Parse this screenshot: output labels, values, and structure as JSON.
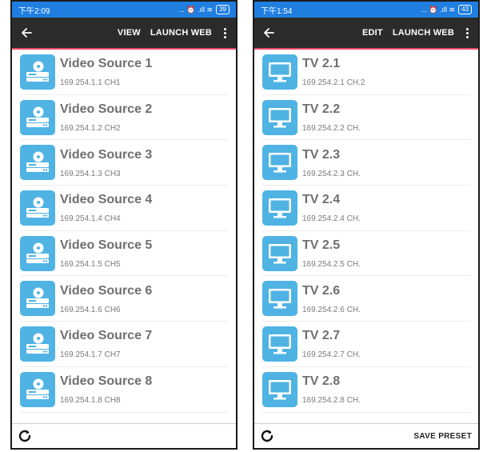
{
  "colors": {
    "status_bar": "#1f7ee0",
    "app_bar": "#2b2b2b",
    "accent_line": "#e84a6a",
    "tile": "#4fb3e4",
    "title_text": "#6f6f6f"
  },
  "left": {
    "status": {
      "time": "下午2:09",
      "indicators": "... ⏰ .ıll ≋",
      "battery": "39"
    },
    "appbar": {
      "back_icon": "arrow-left-icon",
      "view_label": "VIEW",
      "launch_web_label": "LAUNCH WEB",
      "more_icon": "more-vert-icon"
    },
    "items": [
      {
        "title": "Video Source 1",
        "ip": "169.254.1.1",
        "ch": "CH1",
        "icon": "video-player-icon"
      },
      {
        "title": "Video Source 2",
        "ip": "169.254.1.2",
        "ch": "CH2",
        "icon": "video-player-icon"
      },
      {
        "title": "Video Source 3",
        "ip": "169.254.1.3",
        "ch": "CH3",
        "icon": "video-player-icon"
      },
      {
        "title": "Video Source 4",
        "ip": "169.254.1.4",
        "ch": "CH4",
        "icon": "video-player-icon"
      },
      {
        "title": "Video Source 5",
        "ip": "169.254.1.5",
        "ch": "CH5",
        "icon": "video-player-icon"
      },
      {
        "title": "Video Source 6",
        "ip": "169.254.1.6",
        "ch": "CH6",
        "icon": "video-player-icon"
      },
      {
        "title": "Video Source 7",
        "ip": "169.254.1.7",
        "ch": "CH7",
        "icon": "video-player-icon"
      },
      {
        "title": "Video Source 8",
        "ip": "169.254.1.8",
        "ch": "CH8",
        "icon": "video-player-icon"
      }
    ],
    "bottom": {
      "refresh_icon": "refresh-icon"
    }
  },
  "right": {
    "status": {
      "time": "下午1:54",
      "indicators": "... ⏰ .ıll ≋",
      "battery": "43"
    },
    "appbar": {
      "back_icon": "arrow-left-icon",
      "edit_label": "EDIT",
      "launch_web_label": "LAUNCH WEB",
      "more_icon": "more-vert-icon"
    },
    "items": [
      {
        "title": "TV 2.1",
        "ip": "169.254.2.1",
        "ch": "CH.2",
        "icon": "monitor-icon"
      },
      {
        "title": "TV 2.2",
        "ip": "169.254.2.2",
        "ch": "CH.",
        "icon": "monitor-icon"
      },
      {
        "title": "TV 2.3",
        "ip": "169.254.2.3",
        "ch": "CH.",
        "icon": "monitor-icon"
      },
      {
        "title": "TV 2.4",
        "ip": "169.254.2.4",
        "ch": "CH.",
        "icon": "monitor-icon"
      },
      {
        "title": "TV 2.5",
        "ip": "169.254.2.5",
        "ch": "CH.",
        "icon": "monitor-icon"
      },
      {
        "title": "TV 2.6",
        "ip": "169.254.2.6",
        "ch": "CH.",
        "icon": "monitor-icon"
      },
      {
        "title": "TV 2.7",
        "ip": "169.254.2.7",
        "ch": "CH.",
        "icon": "monitor-icon"
      },
      {
        "title": "TV 2.8",
        "ip": "169.254.2.8",
        "ch": "CH.",
        "icon": "monitor-icon"
      }
    ],
    "bottom": {
      "refresh_icon": "refresh-icon",
      "save_preset_label": "SAVE PRESET"
    }
  }
}
